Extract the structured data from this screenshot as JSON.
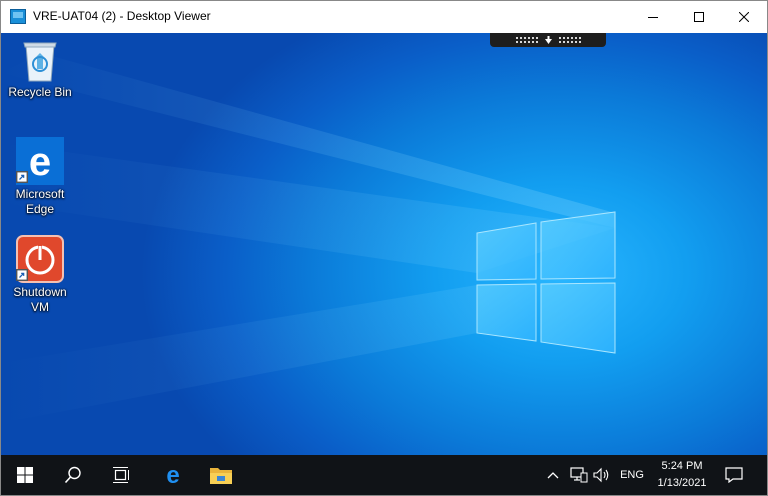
{
  "window": {
    "title": "VRE-UAT04 (2) - Desktop Viewer",
    "controls": [
      "minimize",
      "maximize",
      "close"
    ]
  },
  "desktop": {
    "icons": [
      {
        "label": "Recycle Bin",
        "icon": "recycle-bin-icon"
      },
      {
        "label": "Microsoft Edge",
        "icon": "edge-icon"
      },
      {
        "label": "Shutdown VM",
        "icon": "power-icon"
      }
    ],
    "toolbar_handle": "viewer-toolbar-handle"
  },
  "taskbar": {
    "items": [
      "start-icon",
      "search-icon",
      "task-view-icon",
      "edge-icon",
      "file-explorer-icon"
    ],
    "tray": {
      "language": "ENG",
      "time": "5:24 PM",
      "date": "1/13/2021"
    }
  },
  "colors": {
    "desktop_blue": "#0b7ad8",
    "taskbar": "#101317",
    "edge_tile": "#0a6fd6",
    "shutdown_tile": "#e0482c"
  }
}
